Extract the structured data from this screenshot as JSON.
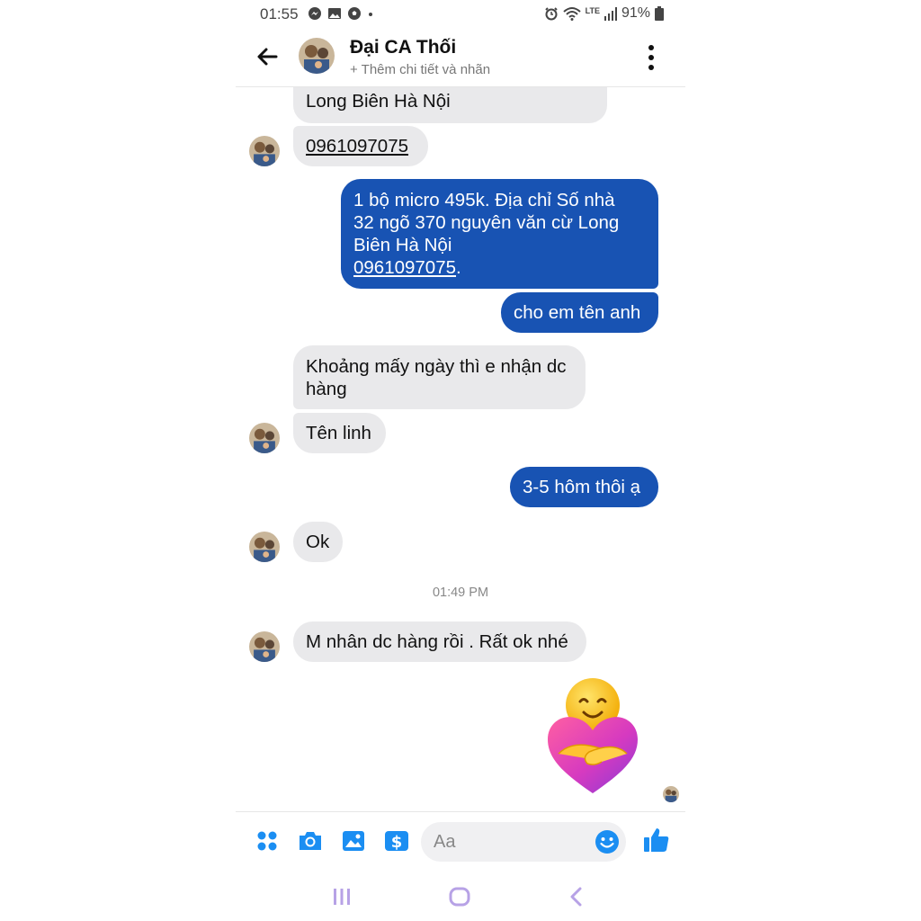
{
  "status_bar": {
    "time": "01:55",
    "network": "LTE",
    "battery": "91%",
    "icons": [
      "messenger-icon",
      "gallery-icon",
      "soccer-icon",
      "dot-icon",
      "alarm-icon",
      "wifi-icon",
      "signal-icon",
      "battery-icon"
    ]
  },
  "header": {
    "name": "Đại CA Thối",
    "subtitle": "+ Thêm chi tiết và nhãn",
    "back_icon": "arrow-left-icon",
    "more_icon": "more-vertical-icon"
  },
  "messages": [
    {
      "from": "them",
      "text": "Long Biên Hà Nội"
    },
    {
      "from": "them",
      "text": "0961097075",
      "link": true
    },
    {
      "from": "me",
      "line1": "1 bộ micro 495k. Địa chỉ Số nhà",
      "line2": "32 ngõ 370 nguyên văn cừ Long",
      "line3": "Biên Hà Nội",
      "phone": "0961097075",
      "suffix": "."
    },
    {
      "from": "me",
      "text": "cho em tên anh"
    },
    {
      "from": "them",
      "line1": "Khoảng mấy ngày thì e nhận dc",
      "line2": "hàng"
    },
    {
      "from": "them",
      "text": "Tên linh"
    },
    {
      "from": "me",
      "text": "3-5 hôm thôi ạ"
    },
    {
      "from": "them",
      "text": "Ok"
    },
    {
      "from": "them",
      "text": "M nhân dc hàng rồi . Rất ok nhé"
    }
  ],
  "timestamp": "01:49 PM",
  "sticker": "hugging-heart-sticker",
  "composer": {
    "placeholder": "Aa",
    "icons": [
      "apps-icon",
      "camera-icon",
      "image-icon",
      "payment-icon",
      "emoji-icon",
      "thumbs-up-icon"
    ],
    "accent": "#1b8ef2"
  },
  "colors": {
    "outgoing_bubble": "#1853b3",
    "incoming_bubble": "#e9e9eb"
  },
  "nav_bar": {
    "icons": [
      "recent-apps-icon",
      "home-icon",
      "back-icon"
    ],
    "color": "#b7a2e6"
  }
}
